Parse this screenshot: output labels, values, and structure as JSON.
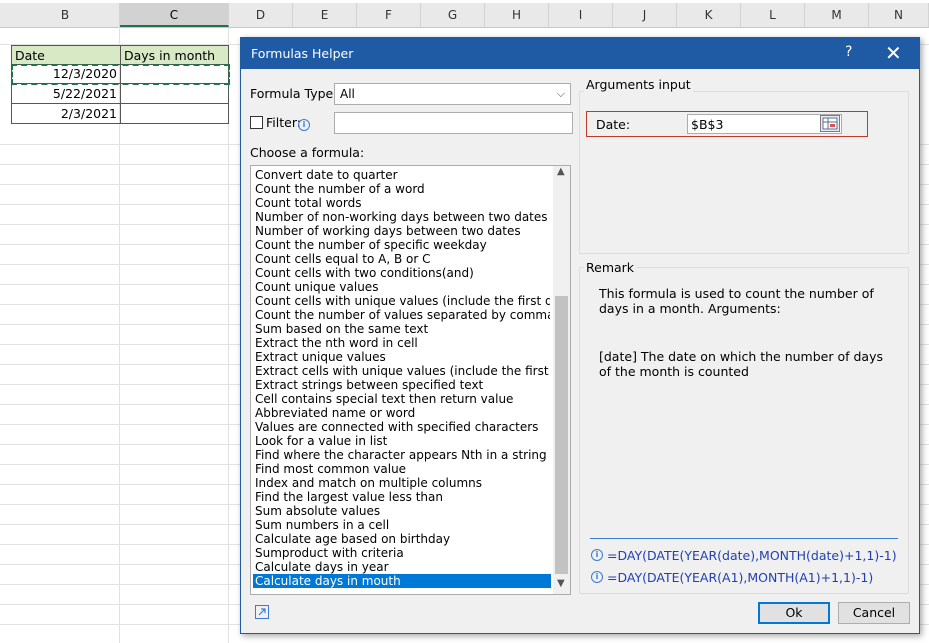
{
  "sheet": {
    "columns": [
      "B",
      "C",
      "D",
      "E",
      "F",
      "G",
      "H",
      "I",
      "J",
      "K",
      "L",
      "M",
      "N"
    ],
    "selected_column": "C",
    "header_row": [
      "Date",
      "Days in month"
    ],
    "dates": [
      "12/3/2020",
      "5/22/2021",
      "2/3/2021"
    ]
  },
  "dialog": {
    "title": "Formulas Helper",
    "help_label": "?",
    "close_label": "✕",
    "formula_type_label": "Formula Type:",
    "formula_type_value": "All",
    "filter_label": "Filter:",
    "filter_value": "",
    "choose_label": "Choose a formula:",
    "formulas": [
      "Convert date to quarter",
      "Count the number of a word",
      "Count total words",
      "Number of non-working days between two dates",
      "Number of working days between two dates",
      "Count the number of specific weekday",
      "Count cells equal to A, B or C",
      "Count cells with two conditions(and)",
      "Count unique values",
      "Count cells with unique values (include the first duplica",
      "Count the number of values separated by comma",
      "Sum based on the same text",
      "Extract the nth word in cell",
      "Extract unique values",
      "Extract cells with unique values (include the first duplic",
      "Extract strings between specified text",
      "Cell contains special text then return value",
      "Abbreviated name or word",
      "Values are connected with specified characters",
      "Look for a value in list",
      "Find where the character appears Nth in a string",
      "Find most common value",
      "Index and match on multiple columns",
      "Find the largest value less than",
      "Sum absolute values",
      "Sum numbers in a cell",
      "Calculate age based on birthday",
      "Sumproduct with criteria",
      "Calculate days in year",
      "Calculate days in mouth"
    ],
    "selected_formula_index": 29,
    "arguments_label": "Arguments input",
    "argument_name": "Date:",
    "argument_value": "$B$3",
    "remark_label": "Remark",
    "remark_text": "This formula is used to count the number of days in a month. Arguments:",
    "remark_arg": "[date] The date on which the number of days of the month is counted",
    "formula_generic": "=DAY(DATE(YEAR(date),MONTH(date)+1,1)-1)",
    "formula_applied": "=DAY(DATE(YEAR(A1),MONTH(A1)+1,1)-1)",
    "ok_label": "Ok",
    "cancel_label": "Cancel"
  },
  "colors": {
    "title_bar": "#1f5aa5",
    "selection": "#0078d7",
    "header_fill": "#d8e9c6",
    "error_outline": "#c0392b",
    "formula_text": "#1f3fb5"
  }
}
